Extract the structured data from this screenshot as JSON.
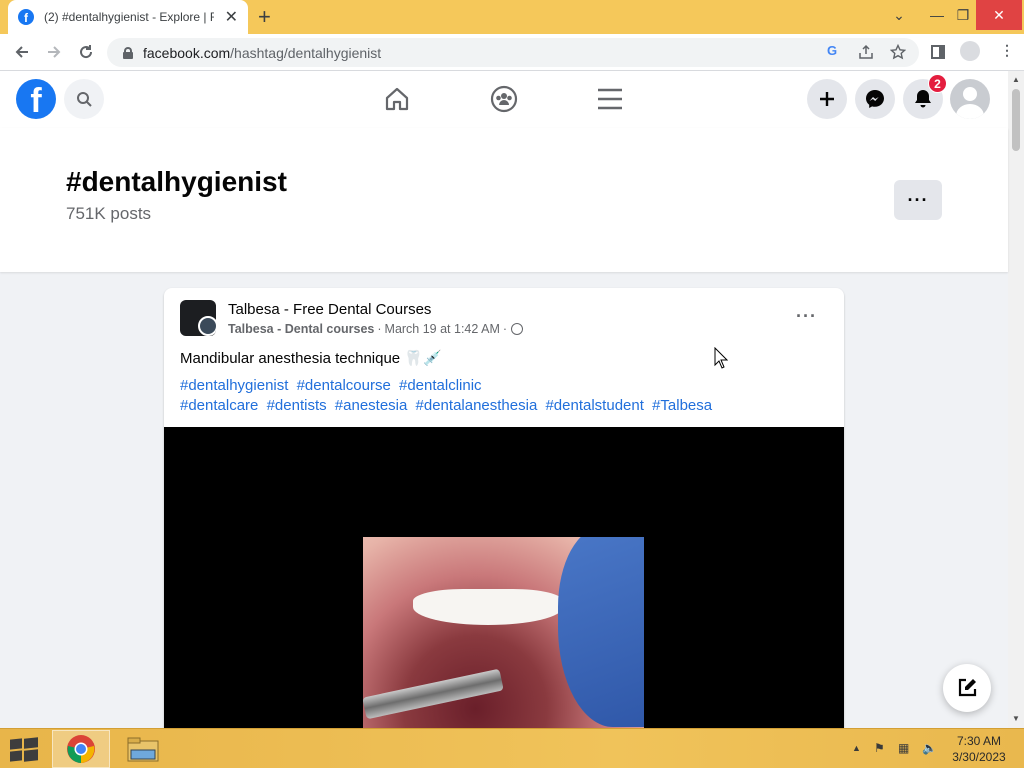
{
  "browser": {
    "tab_title": "(2) #dentalhygienist - Explore | Fa",
    "tab_favicon": "f",
    "new_tab": "+",
    "url_domain": "facebook.com",
    "url_path": "/hashtag/dentalhygienist",
    "window_controls": {
      "chevron": "⌄",
      "minimize": "—",
      "restore": "❐",
      "close": "✕"
    }
  },
  "facebook": {
    "logo": "f",
    "notification_count": "2",
    "icons": [
      "search-icon",
      "home-icon",
      "groups-icon",
      "menu-icon",
      "create-icon",
      "messenger-icon",
      "bell-icon",
      "avatar"
    ],
    "accent": "#1877f2"
  },
  "hashtag": {
    "title": "#dentalhygienist",
    "post_count": "751K posts",
    "more": "···"
  },
  "post": {
    "page_name": "Talbesa - Free Dental Courses",
    "group_name": "Talbesa - Dental courses",
    "timestamp": "March 19 at 1:42 AM",
    "separator": "·",
    "more": "···",
    "text": "Mandibular anesthesia technique 🦷💉",
    "hashtags_line1": [
      "#dentalhygienist",
      "#dentalcourse",
      "#dentalclinic"
    ],
    "hashtags_line2": [
      "#dentalcare",
      "#dentists",
      "#anestesia",
      "#dentalanesthesia",
      "#dentalstudent",
      "#Talbesa"
    ]
  },
  "taskbar": {
    "time": "7:30 AM",
    "date": "3/30/2023",
    "color": "#f0c35a"
  }
}
